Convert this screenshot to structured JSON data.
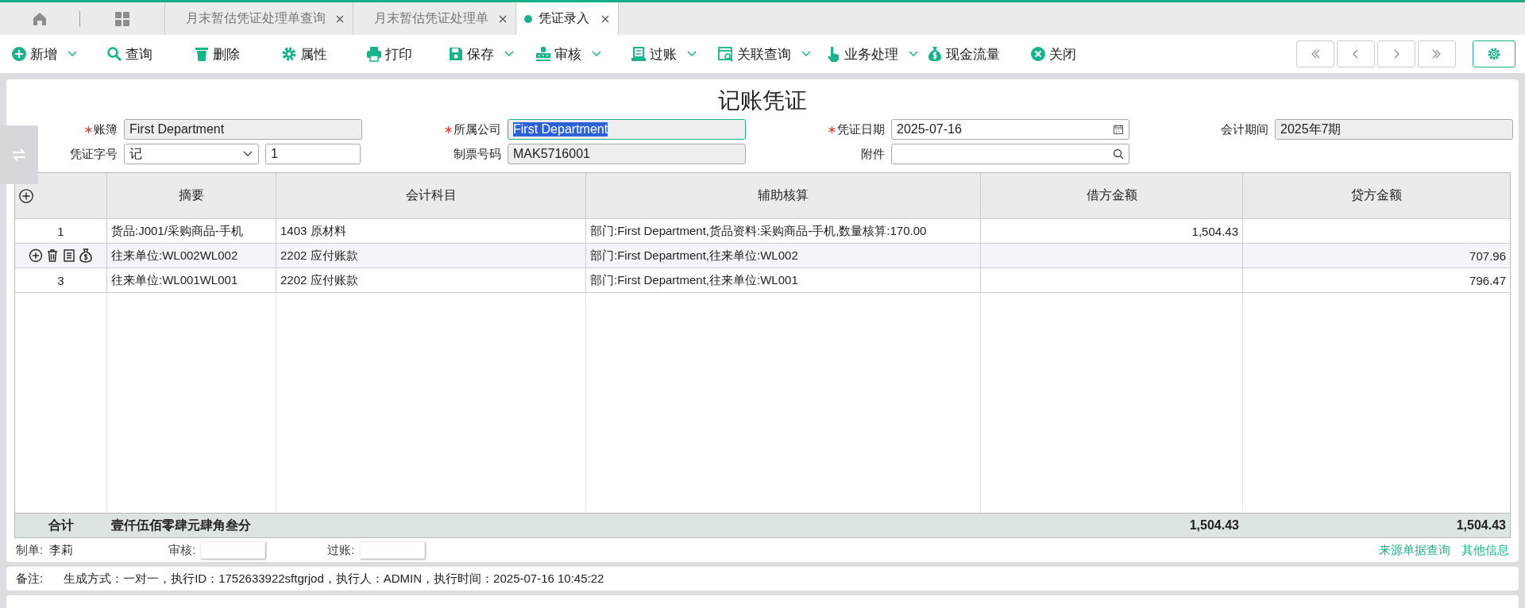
{
  "tabs": [
    {
      "label": "月末暂估凭证处理单查询",
      "selected": false
    },
    {
      "label": "月末暂估凭证处理单",
      "selected": false
    },
    {
      "label": "凭证录入",
      "selected": true
    }
  ],
  "toolbar": [
    {
      "label": "新增",
      "dropdown": true
    },
    {
      "label": "查询",
      "dropdown": false
    },
    {
      "label": "删除",
      "dropdown": false
    },
    {
      "label": "属性",
      "dropdown": false
    },
    {
      "label": "打印",
      "dropdown": false
    },
    {
      "label": "保存",
      "dropdown": true
    },
    {
      "label": "审核",
      "dropdown": true
    },
    {
      "label": "过账",
      "dropdown": true
    },
    {
      "label": "关联查询",
      "dropdown": true
    },
    {
      "label": "业务处理",
      "dropdown": true
    },
    {
      "label": "现金流量",
      "dropdown": false
    },
    {
      "label": "关闭",
      "dropdown": false
    }
  ],
  "title": "记账凭证",
  "form": [
    {
      "label": "账簿",
      "required": true,
      "kind": "text",
      "value": "First Department",
      "focused": false
    },
    {
      "label": "所属公司",
      "required": true,
      "kind": "text",
      "value": "First Department",
      "focused": true
    },
    {
      "label": "凭证日期",
      "required": true,
      "kind": "date",
      "value": "2025-07-16",
      "focused": false
    },
    {
      "label": "会计期间",
      "required": false,
      "kind": "text",
      "value": "2025年7期",
      "focused": false
    },
    {
      "label": "凭证字号",
      "required": false,
      "kind": "select",
      "value": "记",
      "extra": "1",
      "focused": false
    },
    {
      "label": "制票号码",
      "required": false,
      "kind": "text",
      "value": "MAK5716001",
      "focused": false
    },
    {
      "label": "附件",
      "required": false,
      "kind": "search",
      "focused": false
    }
  ],
  "table": {
    "columns": [
      "摘要",
      "会计科目",
      "辅助核算",
      "借方金额",
      "贷方金额"
    ],
    "rows": [
      {
        "number": "1",
        "hovered": false,
        "summary": "货品:J001/采购商品-手机",
        "account": "1403 原材料",
        "auxiliary": "部门:First Department,货品资料:采购商品-手机,数量核算:170.00",
        "debit": "1,504.43"
      },
      {
        "hovered": true,
        "summary": "往来单位:WL002WL002",
        "account": "2202 应付账款",
        "auxiliary": "部门:First Department,往来单位:WL002",
        "credit": "707.96"
      },
      {
        "number": "3",
        "hovered": false,
        "summary": "往来单位:WL001WL001",
        "account": "2202 应付账款",
        "auxiliary": "部门:First Department,往来单位:WL001",
        "credit": "796.47"
      }
    ],
    "total": {
      "label": "合计",
      "words": "壹仟伍佰零肆元肆角叁分",
      "debit": "1,504.43",
      "credit": "1,504.43"
    }
  },
  "footer": {
    "maker_label": "制单:",
    "maker": "李莉",
    "review_label": "审核:",
    "post_label": "过账:",
    "links": [
      "来源单据查询",
      "其他信息"
    ]
  },
  "remark": {
    "label": "备注:",
    "text": "生成方式：一对一，执行ID：1752633922sftgrjod，执行人：ADMIN，执行时间：2025-07-16 10:45:22"
  }
}
